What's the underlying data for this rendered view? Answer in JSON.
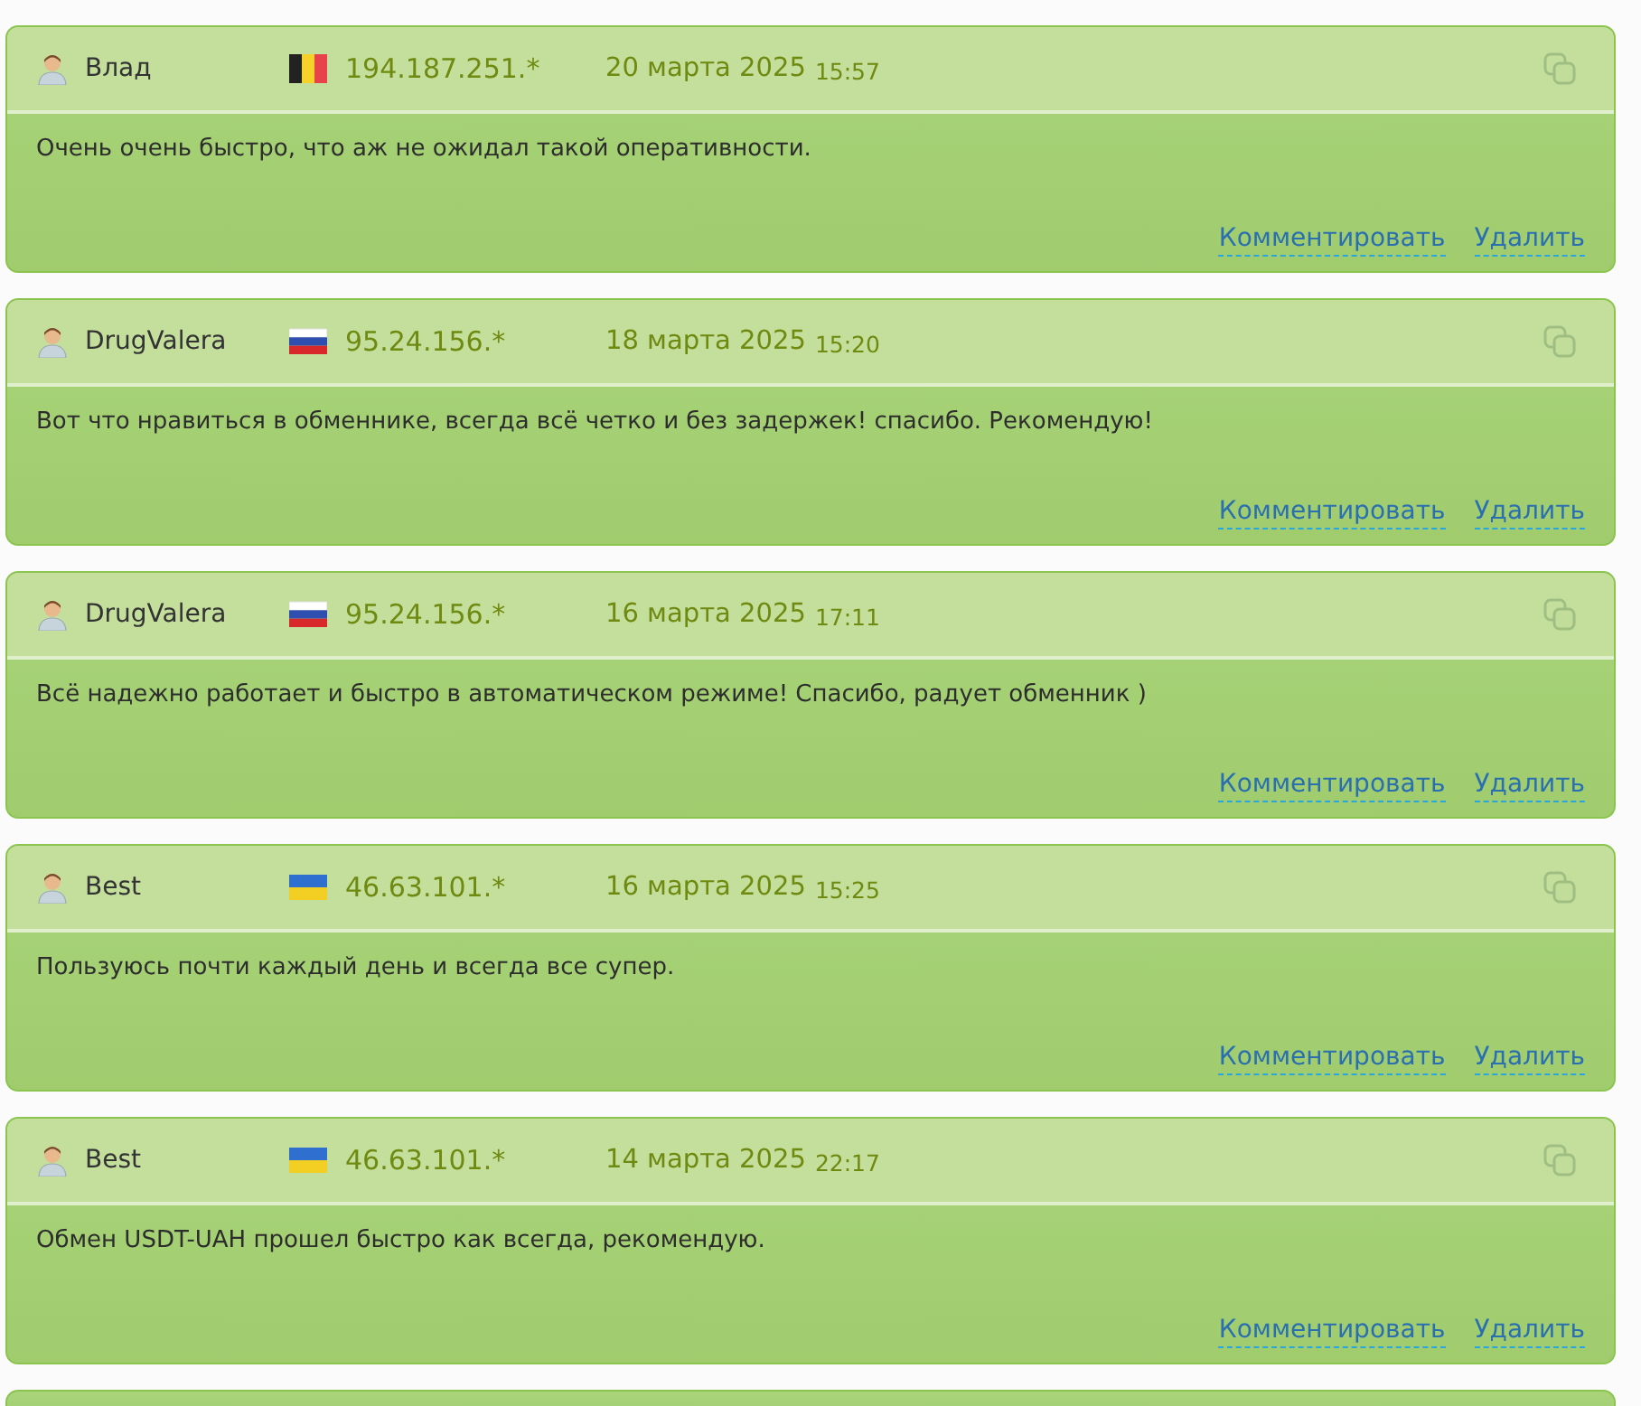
{
  "reviews": [
    {
      "author": "Влад",
      "kind": "belgium",
      "ip": "194.187.251.*",
      "date": "20 марта 2025",
      "time": "15:57",
      "text": "Очень очень быстро, что аж не ожидал такой оперативности.",
      "actions": [
        "Комментировать",
        "Удалить"
      ]
    },
    {
      "author": "DrugValera",
      "kind": "russia",
      "ip": "95.24.156.*",
      "date": "18 марта 2025",
      "time": "15:20",
      "text": "Вот что нравиться в обменнике, всегда всё четко и без задержек! спасибо. Рекомендую!",
      "actions": [
        "Комментировать",
        "Удалить"
      ]
    },
    {
      "author": "DrugValera",
      "kind": "russia",
      "ip": "95.24.156.*",
      "date": "16 марта 2025",
      "time": "17:11",
      "text": "Всё надежно работает и быстро в автоматическом режиме! Спасибо, радует обменник )",
      "actions": [
        "Комментировать",
        "Удалить"
      ]
    },
    {
      "author": "Best",
      "kind": "ukraine",
      "ip": "46.63.101.*",
      "date": "16 марта 2025",
      "time": "15:25",
      "text": "Пользуюсь почти каждый день и всегда все супер.",
      "actions": [
        "Комментировать",
        "Удалить"
      ]
    },
    {
      "author": "Best",
      "kind": "ukraine",
      "ip": "46.63.101.*",
      "date": "14 марта 2025",
      "time": "22:17",
      "text": "Обмен USDT-UAH прошел быстро как всегда, рекомендую.",
      "actions": [
        "Комментировать",
        "Удалить"
      ]
    }
  ]
}
